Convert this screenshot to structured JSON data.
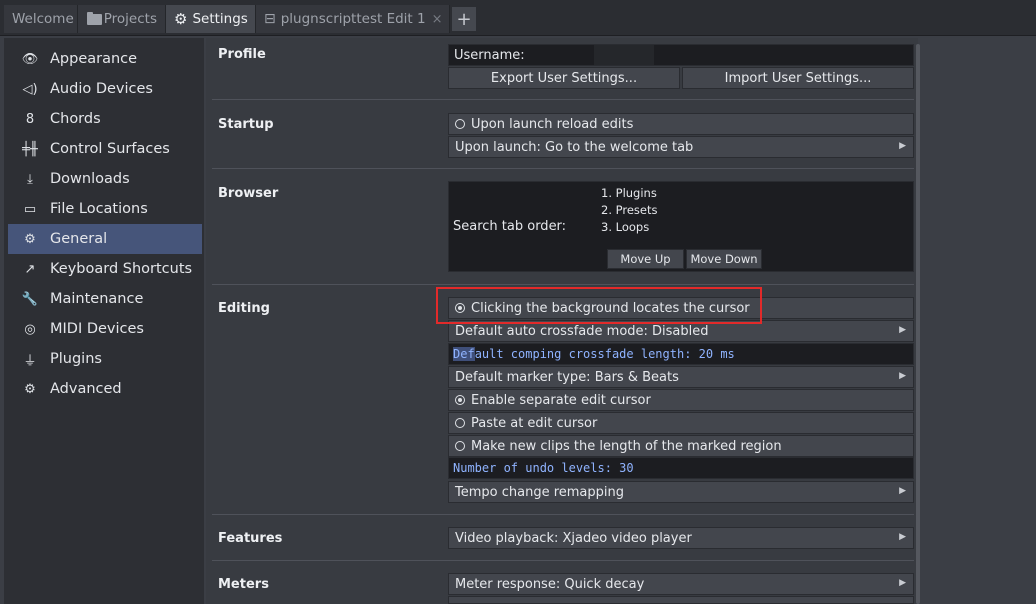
{
  "tabs": [
    {
      "label": "Welcome",
      "icon": "none"
    },
    {
      "label": "Projects",
      "icon": "folder-icon"
    },
    {
      "label": "Settings",
      "icon": "gear-icon"
    },
    {
      "label": "plugnscripttest Edit 1",
      "icon": "edit-window-icon"
    }
  ],
  "new_tab_label": "+",
  "close_tab_glyph": "×",
  "sidebar": {
    "items": [
      {
        "label": "Appearance",
        "icon": "eye-icon"
      },
      {
        "label": "Audio Devices",
        "icon": "speaker-icon"
      },
      {
        "label": "Chords",
        "icon": "chord-icon"
      },
      {
        "label": "Control Surfaces",
        "icon": "faders-icon"
      },
      {
        "label": "Downloads",
        "icon": "download-icon"
      },
      {
        "label": "File Locations",
        "icon": "folder-outline-icon"
      },
      {
        "label": "General",
        "icon": "gear-icon",
        "selected": true
      },
      {
        "label": "Keyboard Shortcuts",
        "icon": "external-link-icon"
      },
      {
        "label": "Maintenance",
        "icon": "wrench-icon"
      },
      {
        "label": "MIDI Devices",
        "icon": "midi-icon"
      },
      {
        "label": "Plugins",
        "icon": "plug-icon"
      },
      {
        "label": "Advanced",
        "icon": "gear-icon"
      }
    ]
  },
  "sections": {
    "profile": {
      "label": "Profile",
      "username_label": "Username:",
      "export_label": "Export User Settings...",
      "import_label": "Import User Settings..."
    },
    "startup": {
      "label": "Startup",
      "reload_label": "Upon launch reload edits",
      "welcome_label": "Upon launch: Go to the welcome tab"
    },
    "browser": {
      "label": "Browser",
      "search_order_label": "Search tab order:",
      "order": [
        "1. Plugins",
        "2. Presets",
        "3. Loops"
      ],
      "move_up_label": "Move Up",
      "move_down_label": "Move Down"
    },
    "editing": {
      "label": "Editing",
      "click_bg_label": "Clicking the background locates the cursor",
      "crossfade_mode_label": "Default auto crossfade mode: Disabled",
      "comping_prefix": "Def",
      "comping_rest": "ault comping crossfade length: 20 ms",
      "marker_type_label": "Default marker type: Bars & Beats",
      "separate_cursor_label": "Enable separate edit cursor",
      "paste_label": "Paste at edit cursor",
      "new_clips_label": "Make new clips the length of the marked region",
      "undo_label": "Number of undo levels: 30",
      "tempo_label": "Tempo change remapping"
    },
    "features": {
      "label": "Features",
      "video_label": "Video playback: Xjadeo video player"
    },
    "meters": {
      "label": "Meters",
      "response_label": "Meter response: Quick decay"
    }
  },
  "colors": {
    "selection": "#46557a",
    "highlight_box": "#e22a2a",
    "mono_text": "#8fb3ff"
  }
}
